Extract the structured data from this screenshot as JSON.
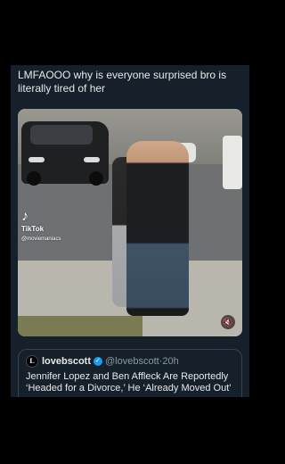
{
  "post": {
    "text": "LMFAOOO why is everyone surprised bro is literally tired of her"
  },
  "media": {
    "watermark_brand": "TikTok",
    "watermark_handle": "@moviemaniacs",
    "volume_icon": "speaker-muted-icon"
  },
  "quote": {
    "avatar_letter": "L",
    "name": "lovebscott",
    "handle": "@lovebscott",
    "separator": "·",
    "time": "20h",
    "text": "Jennifer Lopez and Ben Affleck Are Reportedly ‘Headed for a Divorce,’ He ‘Already Moved Out’"
  },
  "colors": {
    "background": "#000000",
    "panel": "#15202b",
    "text": "#e7e9ea",
    "muted": "#8b98a5",
    "verified": "#1d9bf0"
  }
}
